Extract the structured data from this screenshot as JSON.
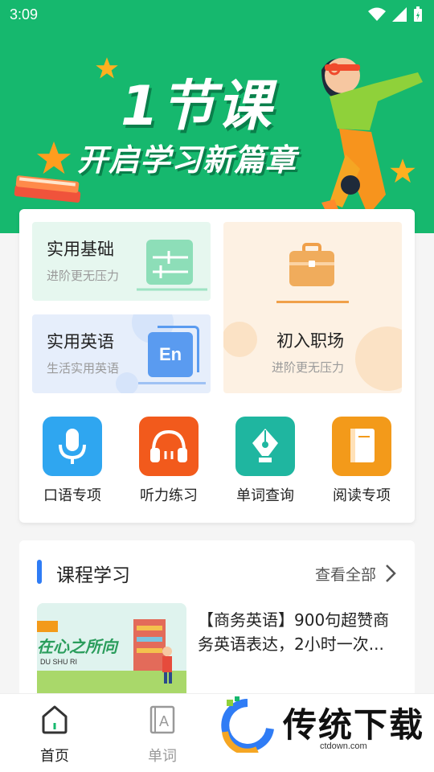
{
  "status": {
    "time": "3:09"
  },
  "banner": {
    "line1": "1节课",
    "line2": "开启学习新篇章"
  },
  "tiles": {
    "basic": {
      "title": "实用基础",
      "subtitle": "进阶更无压力"
    },
    "english": {
      "title": "实用英语",
      "subtitle": "生活实用英语",
      "icon_text": "En"
    },
    "job": {
      "title": "初入职场",
      "subtitle": "进阶更无压力"
    }
  },
  "features": [
    {
      "label": "口语专项",
      "icon": "microphone-icon",
      "color": "#2fa6f0"
    },
    {
      "label": "听力练习",
      "icon": "headphones-icon",
      "color": "#f25a1c"
    },
    {
      "label": "单词查询",
      "icon": "pen-nib-icon",
      "color": "#1fb6a0"
    },
    {
      "label": "阅读专项",
      "icon": "book-icon",
      "color": "#f39a1a"
    }
  ],
  "course": {
    "heading": "课程学习",
    "view_all": "查看全部",
    "item_title": "【商务英语】900句超赞商务英语表达，2小时一次...",
    "thumb_text": "在心之所向",
    "thumb_sub": "DU SHU RI"
  },
  "nav": {
    "home": "首页",
    "words": "单词"
  },
  "watermark": {
    "text": "传统下载",
    "url": "ctdown.com"
  },
  "colors": {
    "brand_green": "#16b86e",
    "accent_blue": "#2f7cf5"
  }
}
